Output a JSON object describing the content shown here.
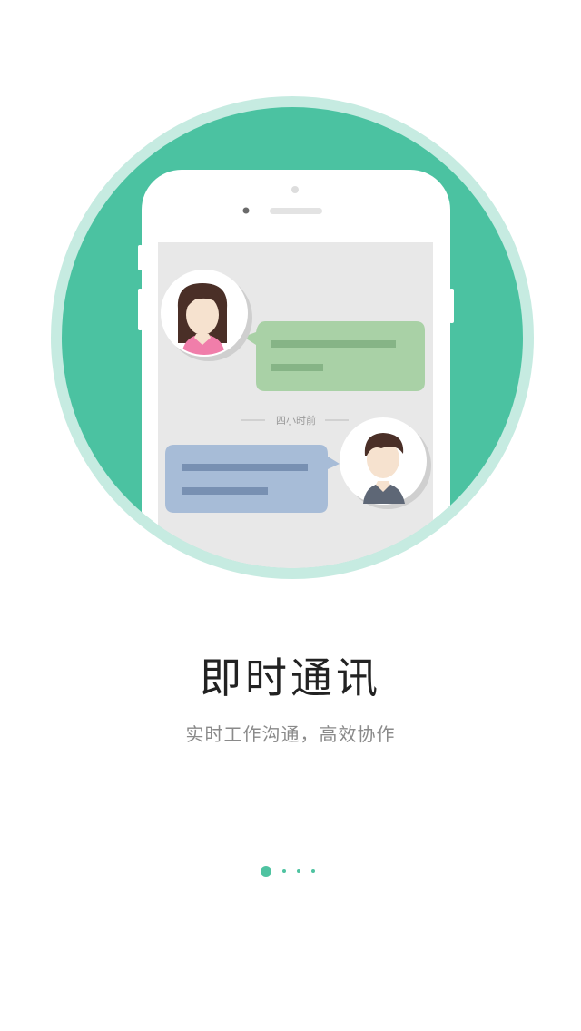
{
  "illustration": {
    "timestamp_label": "四小时前"
  },
  "onboarding": {
    "title": "即时通讯",
    "subtitle": "实时工作沟通，高效协作",
    "current_page": 1,
    "total_pages": 4
  },
  "colors": {
    "accent": "#4bc2a1",
    "ring": "#c6ebe1",
    "incoming_bubble": "#a9d1a6",
    "outgoing_bubble": "#a7bcd7",
    "title_text": "#222222",
    "subtitle_text": "#8a8a8a"
  }
}
